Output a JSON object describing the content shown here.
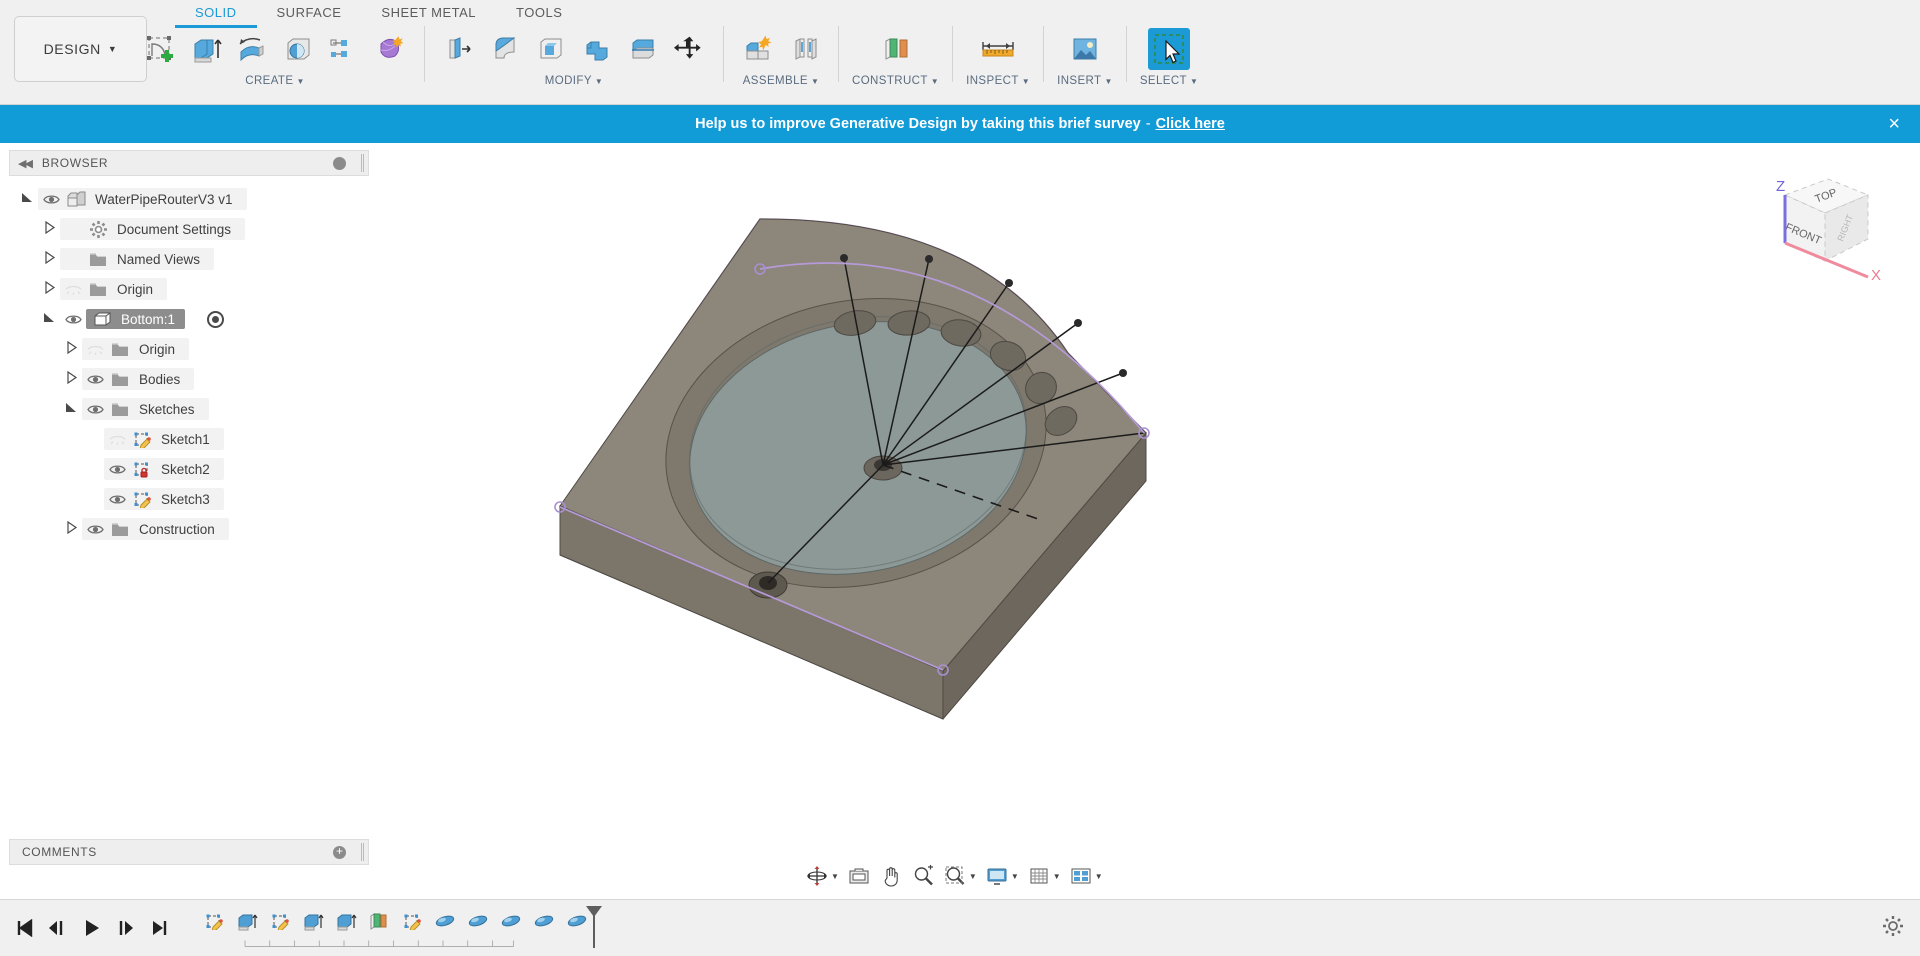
{
  "app": {
    "workspace_label": "DESIGN",
    "tabs": [
      {
        "label": "SOLID",
        "active": true
      },
      {
        "label": "SURFACE",
        "active": false
      },
      {
        "label": "SHEET METAL",
        "active": false
      },
      {
        "label": "TOOLS",
        "active": false
      }
    ]
  },
  "ribbon": {
    "groups": [
      {
        "label": "CREATE",
        "has_caret": true,
        "tools": [
          "create-sketch-icon",
          "extrude-icon",
          "revolve-icon",
          "hole-icon",
          "rib-pattern-icon",
          "form-icon"
        ]
      },
      {
        "label": "MODIFY",
        "has_caret": true,
        "tools": [
          "press-pull-icon",
          "fillet-icon",
          "shell-icon",
          "combine-icon",
          "split-face-icon",
          "move-copy-icon"
        ]
      },
      {
        "label": "ASSEMBLE",
        "has_caret": true,
        "tools": [
          "new-component-icon",
          "joint-icon"
        ]
      },
      {
        "label": "CONSTRUCT",
        "has_caret": true,
        "tools": [
          "offset-plane-icon"
        ]
      },
      {
        "label": "INSPECT",
        "has_caret": true,
        "tools": [
          "measure-icon"
        ]
      },
      {
        "label": "INSERT",
        "has_caret": true,
        "tools": [
          "insert-image-icon"
        ]
      },
      {
        "label": "SELECT",
        "has_caret": true,
        "selected": true,
        "tools": [
          "select-cursor-icon"
        ]
      }
    ]
  },
  "banner": {
    "message": "Help us to improve Generative Design by taking this brief survey",
    "separator": "-",
    "link_label": "Click here",
    "close_label": "×",
    "background": "#119bd7"
  },
  "browser": {
    "title": "BROWSER",
    "collapse_icon": "double-left-chevron-icon",
    "tree": [
      {
        "label": "WaterPipeRouterV3 v1",
        "depth": 0,
        "arrow": "open",
        "eye": "on",
        "icon": "document-icon",
        "selected": false
      },
      {
        "label": "Document Settings",
        "depth": 1,
        "arrow": "closed",
        "eye": "none",
        "icon": "gear-icon",
        "selected": false
      },
      {
        "label": "Named Views",
        "depth": 1,
        "arrow": "closed",
        "eye": "none",
        "icon": "folder-icon",
        "selected": false
      },
      {
        "label": "Origin",
        "depth": 1,
        "arrow": "closed",
        "eye": "off",
        "icon": "folder-icon",
        "selected": false
      },
      {
        "label": "Bottom:1",
        "depth": 1,
        "arrow": "open",
        "eye": "on",
        "icon": "component-icon",
        "selected": true,
        "radio": true
      },
      {
        "label": "Origin",
        "depth": 2,
        "arrow": "closed",
        "eye": "off",
        "icon": "folder-icon",
        "selected": false
      },
      {
        "label": "Bodies",
        "depth": 2,
        "arrow": "closed",
        "eye": "on",
        "icon": "folder-icon",
        "selected": false
      },
      {
        "label": "Sketches",
        "depth": 2,
        "arrow": "open",
        "eye": "on",
        "icon": "folder-icon",
        "selected": false
      },
      {
        "label": "Sketch1",
        "depth": 3,
        "arrow": "none",
        "eye": "off",
        "icon": "sketch-pencil-icon",
        "selected": false
      },
      {
        "label": "Sketch2",
        "depth": 3,
        "arrow": "none",
        "eye": "on",
        "icon": "sketch-lock-icon",
        "selected": false
      },
      {
        "label": "Sketch3",
        "depth": 3,
        "arrow": "none",
        "eye": "on",
        "icon": "sketch-pencil-icon",
        "selected": false
      },
      {
        "label": "Construction",
        "depth": 2,
        "arrow": "closed",
        "eye": "on",
        "icon": "folder-icon",
        "selected": false
      }
    ]
  },
  "comments": {
    "title": "COMMENTS",
    "add_icon": "plus-circle-icon"
  },
  "viewcube": {
    "face_top": "TOP",
    "face_front": "FRONT",
    "face_right": "RIGHT",
    "axis_x": "X",
    "axis_z": "Z"
  },
  "navbar": {
    "items": [
      {
        "name": "orbit-icon",
        "caret": true
      },
      {
        "name": "look-at-icon",
        "caret": false
      },
      {
        "name": "pan-hand-icon",
        "caret": false
      },
      {
        "name": "zoom-icon",
        "caret": false
      },
      {
        "name": "zoom-window-icon",
        "caret": true
      },
      {
        "name": "display-settings-icon",
        "caret": true
      },
      {
        "name": "grid-snaps-icon",
        "caret": true
      },
      {
        "name": "viewports-icon",
        "caret": true
      }
    ]
  },
  "timeline": {
    "playback": [
      "skip-to-start-icon",
      "step-back-icon",
      "play-icon",
      "step-forward-icon",
      "skip-to-end-icon"
    ],
    "features": [
      "sketch-pencil-icon",
      "extrude-icon",
      "sketch-pencil-icon",
      "extrude-icon",
      "extrude-icon",
      "offset-plane-icon",
      "sketch-pencil-icon",
      "fillet-icon",
      "fillet-icon",
      "fillet-icon",
      "fillet-icon",
      "fillet-icon"
    ],
    "marker": "end-of-timeline-marker",
    "settings_icon": "gear-icon"
  },
  "colors": {
    "accent": "#1b9ad6",
    "banner": "#119bd7",
    "toolbar_bg": "#f0f0f0",
    "selection": "#8d8d8d",
    "model_top": "#8a8378",
    "model_cavity": "#8d9b9b",
    "sketch_purple": "#b69ad8"
  }
}
